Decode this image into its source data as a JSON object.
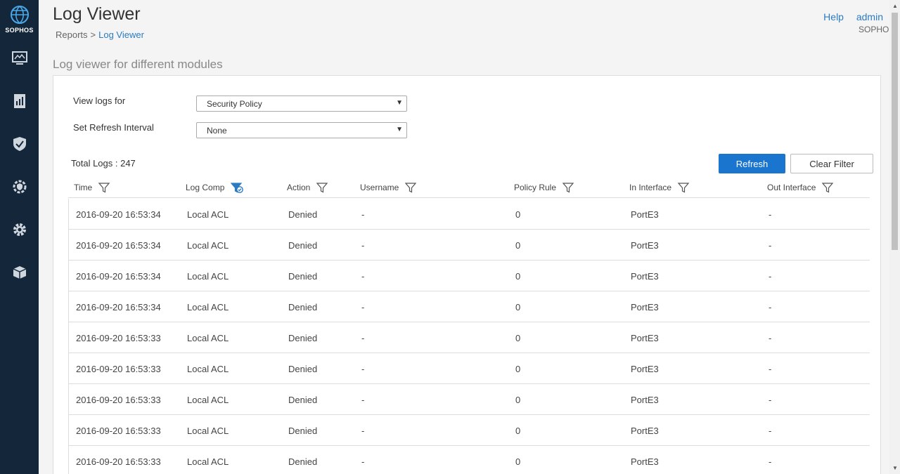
{
  "brand": {
    "name": "SOPHOS"
  },
  "sidebar": {
    "items": [
      {
        "icon": "monitor-icon",
        "name": "monitor-analyze"
      },
      {
        "icon": "report-icon",
        "name": "reports"
      },
      {
        "icon": "shield-icon",
        "name": "protect"
      },
      {
        "icon": "gear-shield-icon",
        "name": "configure"
      },
      {
        "icon": "gear-icon",
        "name": "system"
      },
      {
        "icon": "box-icon",
        "name": "packages"
      }
    ]
  },
  "header": {
    "title": "Log Viewer",
    "breadcrumb": {
      "parent": "Reports",
      "separator": ">",
      "current": "Log Viewer"
    },
    "help": "Help",
    "user": "admin",
    "org": "SOPHOS"
  },
  "section_title": "Log viewer for different modules",
  "form": {
    "view_logs_label": "View logs for",
    "view_logs_value": "Security Policy",
    "refresh_label": "Set Refresh Interval",
    "refresh_value": "None"
  },
  "total_label": "Total Logs : 247",
  "buttons": {
    "refresh": "Refresh",
    "clear_filter": "Clear Filter"
  },
  "table": {
    "columns": [
      "Time",
      "Log Comp",
      "Action",
      "Username",
      "Policy Rule",
      "In Interface",
      "Out Interface"
    ],
    "rows": [
      [
        "2016-09-20 16:53:34",
        "Local ACL",
        "Denied",
        "-",
        "0",
        "PortE3",
        "-"
      ],
      [
        "2016-09-20 16:53:34",
        "Local ACL",
        "Denied",
        "-",
        "0",
        "PortE3",
        "-"
      ],
      [
        "2016-09-20 16:53:34",
        "Local ACL",
        "Denied",
        "-",
        "0",
        "PortE3",
        "-"
      ],
      [
        "2016-09-20 16:53:34",
        "Local ACL",
        "Denied",
        "-",
        "0",
        "PortE3",
        "-"
      ],
      [
        "2016-09-20 16:53:33",
        "Local ACL",
        "Denied",
        "-",
        "0",
        "PortE3",
        "-"
      ],
      [
        "2016-09-20 16:53:33",
        "Local ACL",
        "Denied",
        "-",
        "0",
        "PortE3",
        "-"
      ],
      [
        "2016-09-20 16:53:33",
        "Local ACL",
        "Denied",
        "-",
        "0",
        "PortE3",
        "-"
      ],
      [
        "2016-09-20 16:53:33",
        "Local ACL",
        "Denied",
        "-",
        "0",
        "PortE3",
        "-"
      ],
      [
        "2016-09-20 16:53:33",
        "Local ACL",
        "Denied",
        "-",
        "0",
        "PortE3",
        "-"
      ]
    ]
  },
  "colors": {
    "sidebar": "#14263a",
    "accent": "#1a75cf",
    "link": "#2b7bc2"
  }
}
